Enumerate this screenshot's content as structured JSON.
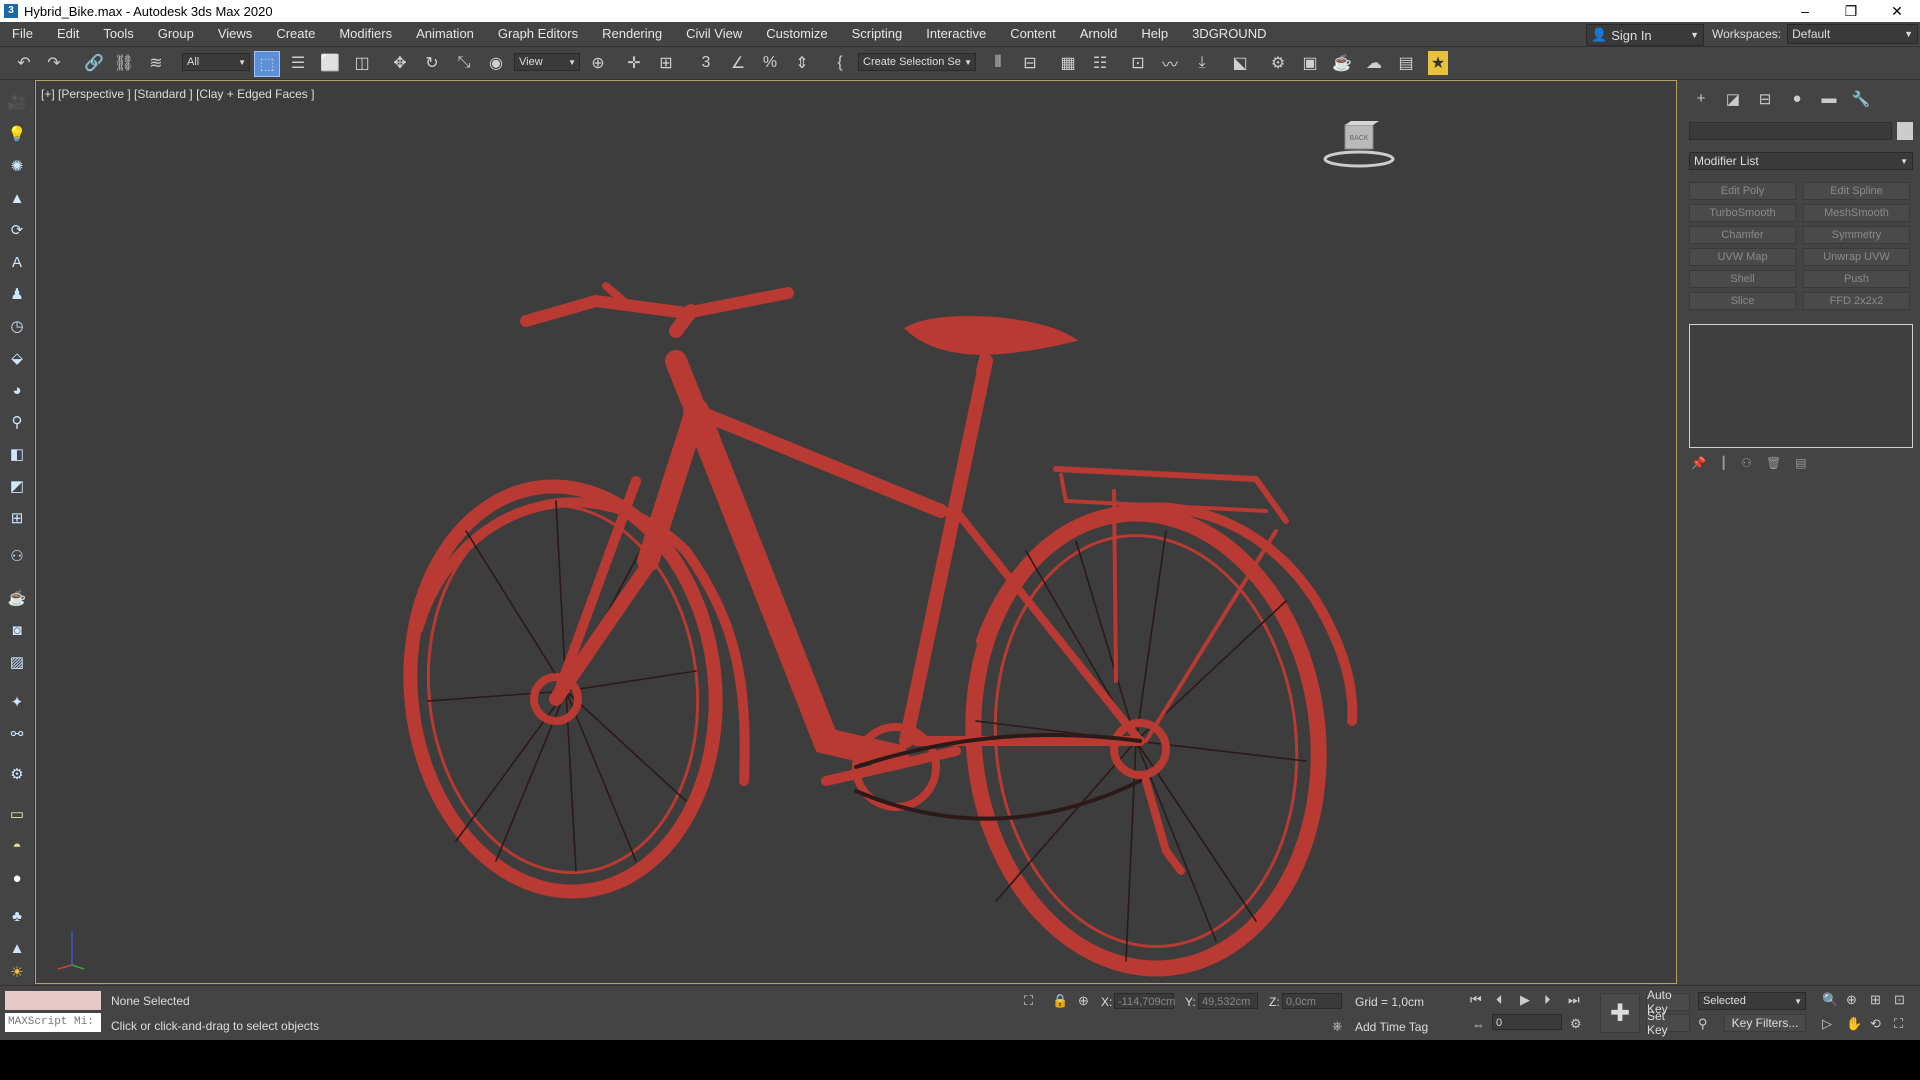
{
  "window": {
    "title": "Hybrid_Bike.max - Autodesk 3ds Max 2020",
    "controls": {
      "minimize": "–",
      "maximize": "❐",
      "close": "✕"
    }
  },
  "menu": [
    "File",
    "Edit",
    "Tools",
    "Group",
    "Views",
    "Create",
    "Modifiers",
    "Animation",
    "Graph Editors",
    "Rendering",
    "Civil View",
    "Customize",
    "Scripting",
    "Interactive",
    "Content",
    "Arnold",
    "Help",
    "3DGROUND"
  ],
  "signin": {
    "label": "Sign In"
  },
  "workspaces": {
    "label": "Workspaces:",
    "value": "Default"
  },
  "toolbar": {
    "filter": "All",
    "refcoord": "View",
    "selection_set": "Create Selection Se"
  },
  "viewport": {
    "label": "[+] [Perspective ] [Standard ] [Clay + Edged Faces ]",
    "viewcube_face": "BACK"
  },
  "command_panel": {
    "modifier_list": "Modifier List",
    "modifier_buttons": [
      "Edit Poly",
      "Edit Spline",
      "TurboSmooth",
      "MeshSmooth",
      "Chamfer",
      "Symmetry",
      "UVW Map",
      "Unwrap UVW",
      "Shell",
      "Push",
      "Slice",
      "FFD 2x2x2"
    ]
  },
  "status": {
    "selection": "None Selected",
    "prompt": "Click or click-and-drag to select objects",
    "maxscript_placeholder": "MAXScript Mi:",
    "x_label": "X:",
    "x_value": "-114,709cm",
    "y_label": "Y:",
    "y_value": "49,532cm",
    "z_label": "Z:",
    "z_value": "0,0cm",
    "grid": "Grid = 1,0cm",
    "add_time_tag": "Add Time Tag",
    "auto_key": "Auto Key",
    "set_key": "Set Key",
    "key_mode": "Selected",
    "key_filters": "Key Filters...",
    "frame": "0"
  },
  "colors": {
    "accent_select": "#5b8fd6",
    "bike_wire": "#b83a32",
    "viewport_border": "#b5a260"
  }
}
